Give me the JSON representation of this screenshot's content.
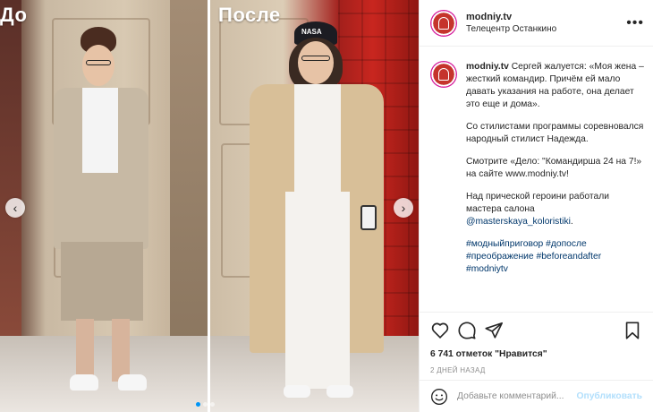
{
  "media": {
    "label_before": "До",
    "label_after": "После",
    "cap_text": "NASA",
    "nav_prev": "‹",
    "nav_next": "›"
  },
  "header": {
    "username": "modniy.tv",
    "location": "Телецентр Останкино"
  },
  "caption": {
    "username": "modniy.tv",
    "p1": "Сергей жалуется: «Моя жена – жесткий командир. Причём ей мало давать указания на работе, она делает это еще и дома».",
    "p2": "Со стилистами программы соревновался народный стилист Надежда.",
    "p3": "Смотрите «Дело: \"Командирша 24 на 7!» на сайте www.modniy.tv!",
    "p4": "Над прической героини работали мастера салона",
    "p4_mention": "@masterskaya_koloristiki",
    "p4_end": ".",
    "tags": "#модныйприговор #допосле #преображение #beforeandafter #modniytv"
  },
  "stats": {
    "likes": "6 741 отметок \"Нравится\"",
    "date": "2 ДНЕЙ НАЗАД"
  },
  "comment": {
    "placeholder": "Добавьте комментарий...",
    "publish": "Опубликовать"
  },
  "icons": {
    "like": "heart-icon",
    "comment": "comment-icon",
    "share": "paper-plane-icon",
    "save": "bookmark-icon",
    "more": "more-icon",
    "emoji": "smiley-icon"
  },
  "colors": {
    "link": "#00376b",
    "publish_disabled": "#b2dffc",
    "muted": "#8e8e8e",
    "carousel_active": "#0095f6"
  }
}
